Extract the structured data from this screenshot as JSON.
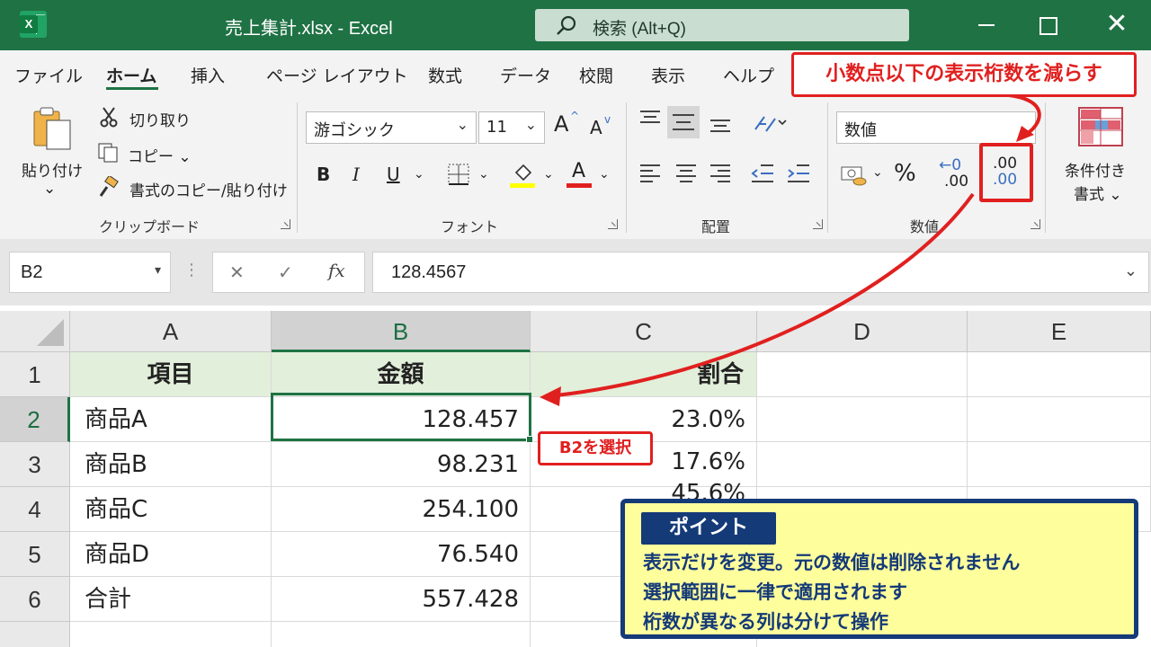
{
  "window": {
    "app_icon_letter": "X",
    "title": "売上集計.xlsx  -  Excel",
    "search_text": "検索 (Alt+Q)",
    "close_glyph": "✕"
  },
  "tabs": [
    "ファイル",
    "ホーム",
    "挿入",
    "ページ レイアウト",
    "数式",
    "データ",
    "校閲",
    "表示",
    "ヘルプ"
  ],
  "active_tab": "ホーム",
  "ribbon": {
    "clipboard": {
      "paste_label_1": "貼り付け",
      "paste_chevron": "⌄",
      "cut": "切り取り",
      "copy": "コピー ⌄",
      "format_painter": "書式のコピー/貼り付け",
      "group_label": "クリップボード"
    },
    "font": {
      "font_name": "游ゴシック",
      "font_size": "11",
      "grow": "A",
      "shrink": "A",
      "bold": "B",
      "italic": "I",
      "underline": "U",
      "font_color_letter": "A",
      "group_label": "フォント"
    },
    "alignment": {
      "group_label": "配置"
    },
    "number": {
      "format": "数値",
      "percent": "%",
      "inc_top": "←0",
      "inc_bottom": ".00",
      "dec_top": ".00",
      "dec_bottom": ".00",
      "group_label": "数値"
    },
    "styles": {
      "conditional_1": "条件付き",
      "conditional_2": "書式 ⌄"
    }
  },
  "formula_bar": {
    "name_box": "B2",
    "name_chevron": "▾",
    "cancel": "✕",
    "enter": "✓",
    "fx": "fx",
    "value": "128.4567",
    "expand_chevron": "⌄"
  },
  "sheet": {
    "columns": [
      "A",
      "B",
      "C",
      "D",
      "E"
    ],
    "rows": [
      "1",
      "2",
      "3",
      "4",
      "5",
      "6"
    ],
    "headers": [
      "項目",
      "金額",
      "割合"
    ],
    "data": [
      {
        "item": "商品A",
        "amount": "128.457",
        "ratio": "23.0%"
      },
      {
        "item": "商品B",
        "amount": "98.231",
        "ratio": "17.6%"
      },
      {
        "item": "商品C",
        "amount": "254.100",
        "ratio": "45.6%"
      },
      {
        "item": "商品D",
        "amount": "76.540",
        "ratio": ""
      },
      {
        "item": "合計",
        "amount": "557.428",
        "ratio": ""
      }
    ]
  },
  "callouts": {
    "top": "小数点以下の表示桁数を減らす",
    "b2": "B2を選択",
    "point_title": "ポイント",
    "point_lines": [
      "表示だけを変更。元の数値は削除されません",
      "選択範囲に一律で適用されます",
      "桁数が異なる列は分けて操作"
    ]
  },
  "colors": {
    "titlebar": "#1f7244",
    "accent_red": "#e0201f",
    "header_fill": "#e2efda",
    "point_fill": "#fffe9c",
    "point_border": "#153a78"
  }
}
